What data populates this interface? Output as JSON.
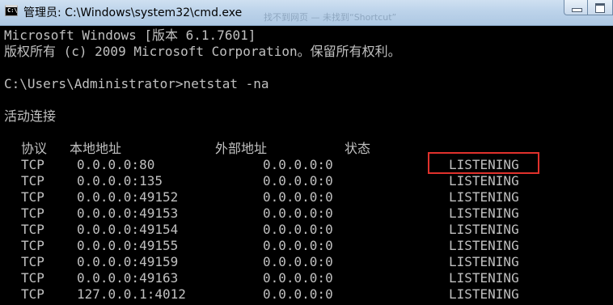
{
  "window": {
    "title": "管理员: C:\\Windows\\system32\\cmd.exe",
    "background_title_fragment": "找不到网页 — 未找到“Shortcut”"
  },
  "console": {
    "lines": [
      "Microsoft Windows [版本 6.1.7601]",
      "版权所有 (c) 2009 Microsoft Corporation。保留所有权利。",
      "",
      "C:\\Users\\Administrator>netstat -na",
      "",
      "活动连接"
    ],
    "headers": {
      "proto": "协议",
      "local": "本地地址",
      "foreign": "外部地址",
      "state": "状态"
    },
    "rows": [
      {
        "proto": "TCP",
        "local": "0.0.0.0:80",
        "foreign": "0.0.0.0:0",
        "state": "LISTENING"
      },
      {
        "proto": "TCP",
        "local": "0.0.0.0:135",
        "foreign": "0.0.0.0:0",
        "state": "LISTENING"
      },
      {
        "proto": "TCP",
        "local": "0.0.0.0:49152",
        "foreign": "0.0.0.0:0",
        "state": "LISTENING"
      },
      {
        "proto": "TCP",
        "local": "0.0.0.0:49153",
        "foreign": "0.0.0.0:0",
        "state": "LISTENING"
      },
      {
        "proto": "TCP",
        "local": "0.0.0.0:49154",
        "foreign": "0.0.0.0:0",
        "state": "LISTENING"
      },
      {
        "proto": "TCP",
        "local": "0.0.0.0:49155",
        "foreign": "0.0.0.0:0",
        "state": "LISTENING"
      },
      {
        "proto": "TCP",
        "local": "0.0.0.0:49159",
        "foreign": "0.0.0.0:0",
        "state": "LISTENING"
      },
      {
        "proto": "TCP",
        "local": "0.0.0.0:49163",
        "foreign": "0.0.0.0:0",
        "state": "LISTENING"
      },
      {
        "proto": "TCP",
        "local": "127.0.0.1:4012",
        "foreign": "0.0.0.0:0",
        "state": "LISTENING"
      }
    ]
  },
  "colors": {
    "console_text": "#c0c0c0",
    "console_background": "#000000",
    "highlight_border": "#e0312c"
  },
  "icons": {
    "app": "cmd-icon",
    "minimize": "minimize-icon",
    "maximize": "maximize-icon"
  }
}
